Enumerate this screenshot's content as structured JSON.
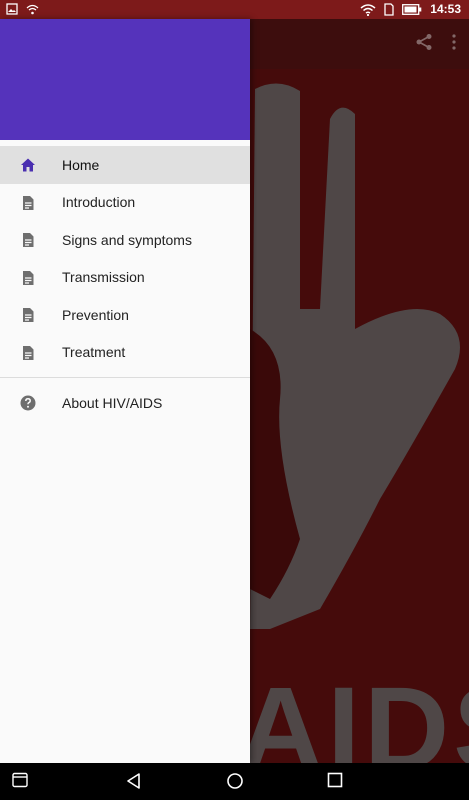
{
  "status_bar": {
    "time": "14:53"
  },
  "drawer": {
    "items": [
      {
        "label": "Home",
        "icon": "home-icon",
        "active": true
      },
      {
        "label": "Introduction",
        "icon": "document-icon"
      },
      {
        "label": "Signs and symptoms",
        "icon": "document-icon"
      },
      {
        "label": "Transmission",
        "icon": "document-icon"
      },
      {
        "label": "Prevention",
        "icon": "document-icon"
      },
      {
        "label": "Treatment",
        "icon": "document-icon"
      }
    ],
    "secondary_items": [
      {
        "label": "About HIV/AIDS",
        "icon": "help-circle-icon"
      }
    ]
  },
  "background": {
    "hero_text": "AIDS"
  },
  "colors": {
    "drawer_header": "#5533bb",
    "accent": "#4a2fb0",
    "status_bar": "#7d1a1a",
    "hero_red": "#6a1212"
  }
}
